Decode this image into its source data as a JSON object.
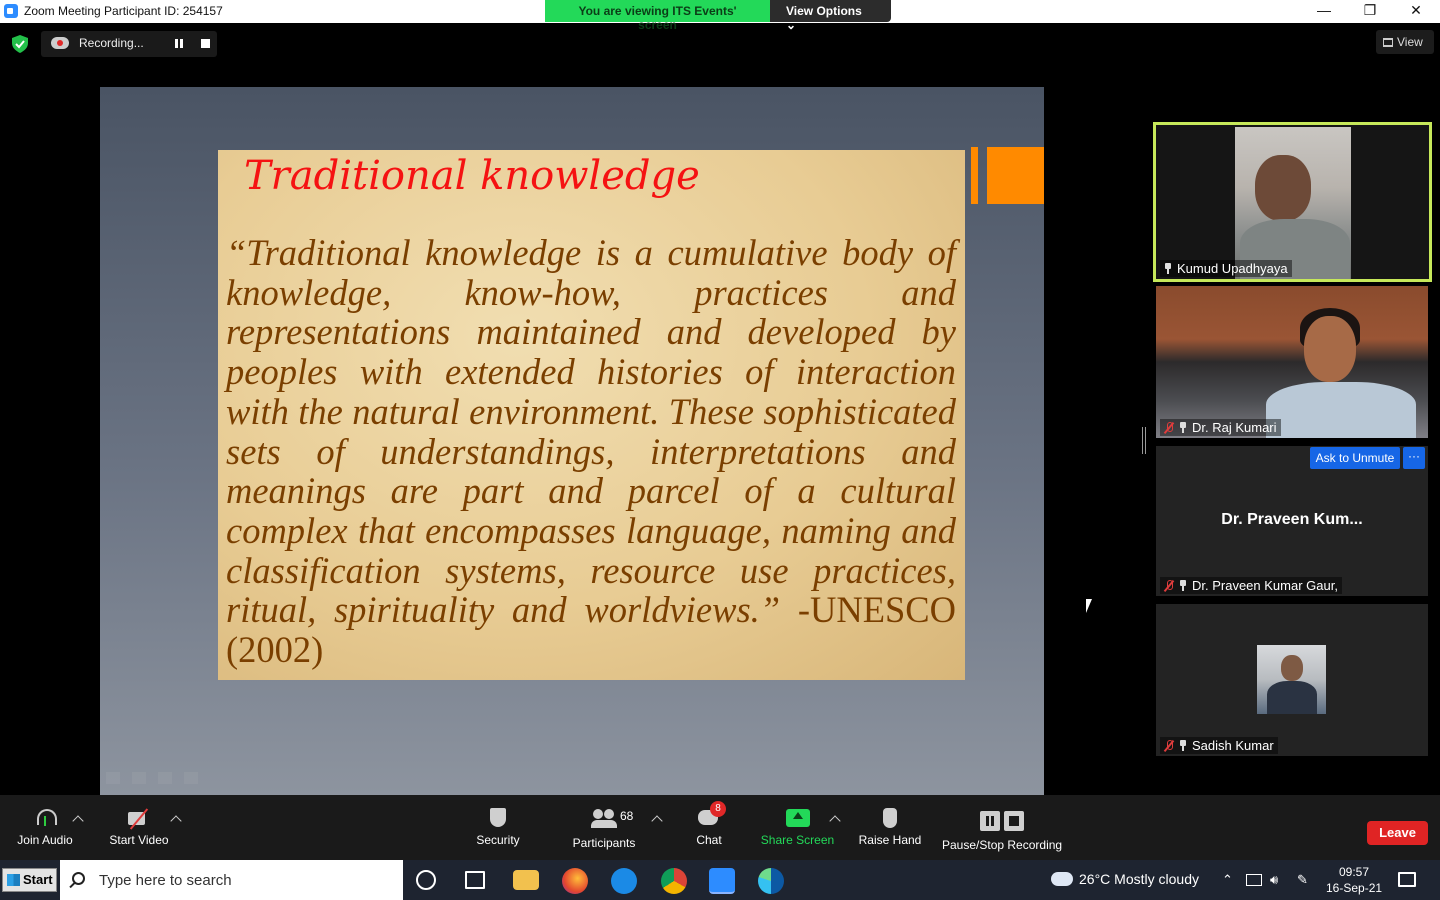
{
  "window": {
    "title": "Zoom Meeting Participant ID: 254157",
    "minimize": "—",
    "maximize": "❐",
    "close": "✕"
  },
  "banner": {
    "viewing_text": "You are viewing ITS Events' screen",
    "view_options": "View Options ⌄"
  },
  "meeting_bar": {
    "recording_label": "Recording...",
    "view_label": "View"
  },
  "slide": {
    "title": "Traditional knowledge",
    "body": "“Traditional knowledge is a cumulative body of knowledge, know-how, practices and representations maintained and developed by peoples with extended histories of interaction with the natural environment. These sophisticated sets of understandings, interpretations and meanings are part and parcel of a cultural complex that encompasses language, naming and classification systems, resource use practices, ritual, spirituality and worldviews.”",
    "citation": " -UNESCO (2002)"
  },
  "participants": [
    {
      "name": "Kumud Upadhyaya",
      "muted": false,
      "active_speaker": true
    },
    {
      "name": "Dr. Raj Kumari",
      "muted": true
    },
    {
      "name": "Dr. Praveen Kumar Gaur,",
      "display_name": "Dr. Praveen Kum...",
      "muted": true,
      "video_off": true
    },
    {
      "name": "Sadish Kumar",
      "muted": true
    }
  ],
  "gallery_actions": {
    "ask_to_unmute": "Ask to Unmute",
    "more": "···"
  },
  "toolbar": {
    "join_audio": "Join Audio",
    "start_video": "Start Video",
    "security": "Security",
    "participants": "Participants",
    "participant_count": "68",
    "chat": "Chat",
    "chat_badge": "8",
    "share_screen": "Share Screen",
    "raise_hand": "Raise Hand",
    "pause_stop_recording": "Pause/Stop Recording",
    "leave": "Leave"
  },
  "taskbar": {
    "start": "Start",
    "search_placeholder": "Type here to search",
    "weather": "26°C  Mostly cloudy",
    "time": "09:57",
    "date": "16-Sep-21"
  },
  "colors": {
    "banner_green": "#23d959",
    "active_speaker_border": "#c6e85a",
    "leave_red": "#e02424",
    "unmute_blue": "#1666e6",
    "slide_title_red": "#f51212",
    "slide_body_brown": "#7a3f00",
    "accent_orange": "#ff8a00"
  }
}
